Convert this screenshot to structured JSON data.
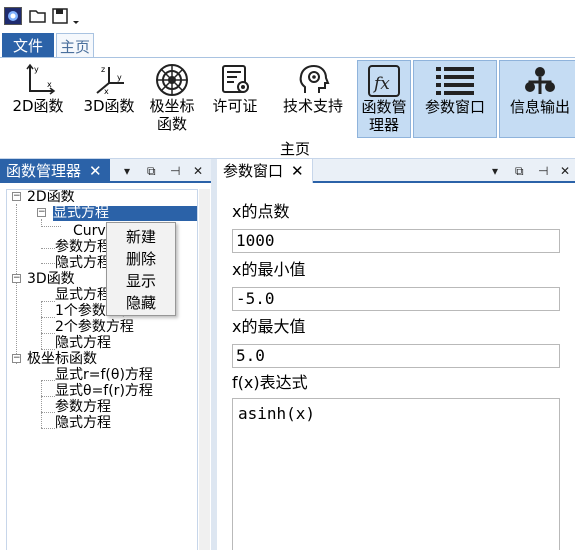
{
  "menu": {
    "file_label": "文件",
    "home_label": "主页"
  },
  "ribbon": {
    "group_label": "主页",
    "buttons": [
      {
        "label": "2D函数",
        "icon": "axes-2d-icon"
      },
      {
        "label": "3D函数",
        "icon": "axes-3d-icon"
      },
      {
        "label1": "极坐标",
        "label2": "函数",
        "icon": "polar-icon"
      },
      {
        "label": "许可证",
        "icon": "certificate-icon"
      },
      {
        "label": "技术支持",
        "icon": "support-icon"
      },
      {
        "label1": "函数管",
        "label2": "理器",
        "icon": "fx-icon"
      },
      {
        "label": "参数窗口",
        "icon": "list-icon"
      },
      {
        "label": "信息输出",
        "icon": "network-icon"
      }
    ]
  },
  "left_panel": {
    "tab_label": "函数管理器",
    "close_glyph": "✕",
    "controls": [
      "▾",
      "⧉",
      "⊣",
      "✕"
    ],
    "tree": {
      "root_2d": "2D函数",
      "explicit": "显式方程",
      "curv": "Curv",
      "param": "参数方程",
      "implicit": "隐式方程",
      "root_3d": "3D函数",
      "explicit_3d": "显式方程",
      "one_param": "1个参数方程",
      "two_param": "2个参数方程",
      "implicit_3d": "隐式方程",
      "root_polar": "极坐标函数",
      "polar_r": "显式r=f(θ)方程",
      "polar_theta": "显式θ=f(r)方程",
      "polar_param": "参数方程",
      "polar_implicit": "隐式方程"
    }
  },
  "context_menu": {
    "items": [
      "新建",
      "删除",
      "显示",
      "隐藏"
    ]
  },
  "right_panel": {
    "tab_label": "参数窗口",
    "close_glyph": "✕",
    "controls": [
      "▾",
      "⧉",
      "⊣",
      "✕"
    ],
    "fields": [
      {
        "label": "x的点数",
        "value": "1000"
      },
      {
        "label": "x的最小值",
        "value": "-5.0"
      },
      {
        "label": "x的最大值",
        "value": "5.0"
      }
    ],
    "expr_label": "f(x)表达式",
    "expr_value": "asinh(x)"
  },
  "colors": {
    "accent": "#2b62a8",
    "ribbon_active": "#c5dcf3",
    "panel_border": "#c7d6ea"
  }
}
